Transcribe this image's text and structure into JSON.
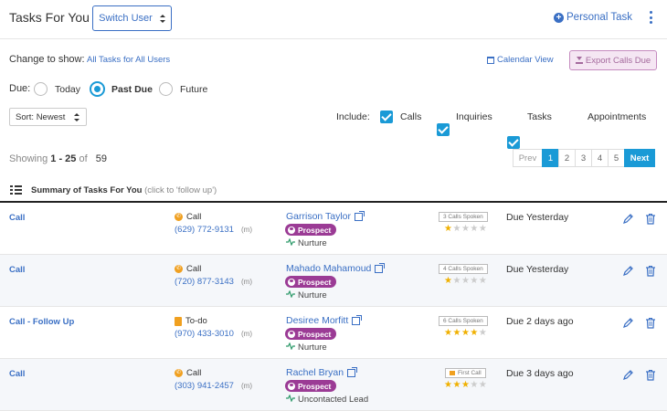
{
  "header": {
    "title": "Tasks For You",
    "switch_user": "Switch User",
    "personal_task": "Personal Task"
  },
  "filters": {
    "change_label": "Change to show:",
    "change_link": "All Tasks for All Users",
    "calendar_view": "Calendar View",
    "export_calls": "Export Calls Due",
    "due_label": "Due:",
    "due_options": [
      {
        "label": "Today",
        "selected": false
      },
      {
        "label": "Past Due",
        "selected": true
      },
      {
        "label": "Future",
        "selected": false
      }
    ],
    "sort": "Sort: Newest",
    "include_label": "Include:",
    "include_options": [
      {
        "label": "Calls",
        "checked": true
      },
      {
        "label": "Inquiries",
        "checked": true
      },
      {
        "label": "Tasks",
        "checked": true
      },
      {
        "label": "Appointments",
        "checked": true
      }
    ]
  },
  "results": {
    "showing_prefix": "Showing",
    "range": "1 - 25",
    "of": "of",
    "total": "59"
  },
  "pagination": {
    "prev": "Prev",
    "pages": [
      "1",
      "2",
      "3",
      "4",
      "5"
    ],
    "active_page": "1",
    "next": "Next"
  },
  "summary": {
    "title": "Summary of Tasks For You",
    "hint": "(click to 'follow up')"
  },
  "tasks": [
    {
      "type": "Call",
      "kind": "Call",
      "kind_icon": "phone-icon",
      "phone": "(629) 772-9131",
      "phone_type": "(m)",
      "person": "Garrison Taylor",
      "badge": "Prospect",
      "stage": "Nurture",
      "calls_badge": "3 Calls Spoken",
      "rating": 1,
      "due": "Due Yesterday"
    },
    {
      "type": "Call",
      "kind": "Call",
      "kind_icon": "phone-icon",
      "phone": "(720) 877-3143",
      "phone_type": "(m)",
      "person": "Mahado Mahamoud",
      "badge": "Prospect",
      "stage": "Nurture",
      "calls_badge": "4 Calls Spoken",
      "rating": 1,
      "due": "Due Yesterday"
    },
    {
      "type": "Call - Follow Up",
      "kind": "To-do",
      "kind_icon": "todo-icon",
      "phone": "(970) 433-3010",
      "phone_type": "(m)",
      "person": "Desiree Morfitt",
      "badge": "Prospect",
      "stage": "Nurture",
      "calls_badge": "6 Calls Spoken",
      "rating": 4,
      "due": "Due 2 days ago"
    },
    {
      "type": "Call",
      "kind": "Call",
      "kind_icon": "phone-icon",
      "phone": "(303) 941-2457",
      "phone_type": "(m)",
      "person": "Rachel Bryan",
      "badge": "Prospect",
      "stage": "Uncontacted Lead",
      "calls_badge": "First Call",
      "rating": 3,
      "due": "Due 3 days ago"
    }
  ]
}
